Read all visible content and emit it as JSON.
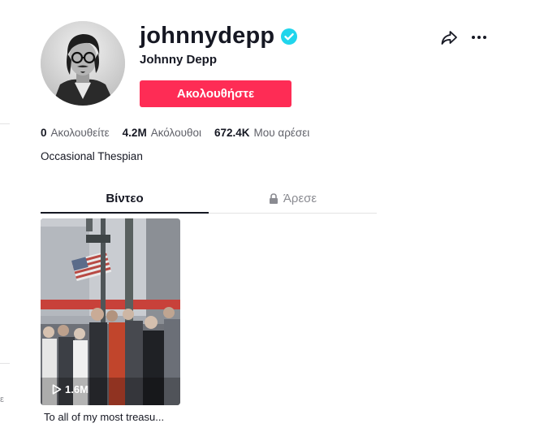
{
  "profile": {
    "username": "johnnydepp",
    "nickname": "Johnny Depp",
    "verified": true,
    "follow_label": "Ακολουθήστε",
    "bio": "Occasional Thespian",
    "accent_color": "#fe2c55",
    "verified_color": "#20d5ec"
  },
  "stats": [
    {
      "value": "0",
      "label": "Ακολουθείτε"
    },
    {
      "value": "4.2M",
      "label": "Ακόλουθοι"
    },
    {
      "value": "672.4K",
      "label": "Μου αρέσει"
    }
  ],
  "tabs": [
    {
      "label": "Βίντεο",
      "active": true
    },
    {
      "label": "Άρεσε",
      "active": false,
      "icon": "lock-icon"
    }
  ],
  "videos": [
    {
      "views": "1.6M",
      "caption": "To all of my most treasu..."
    }
  ],
  "left_fragment": "ε",
  "icons": {
    "share": "share-icon",
    "more": "more-icon",
    "verified": "verified-icon",
    "play": "play-icon"
  }
}
